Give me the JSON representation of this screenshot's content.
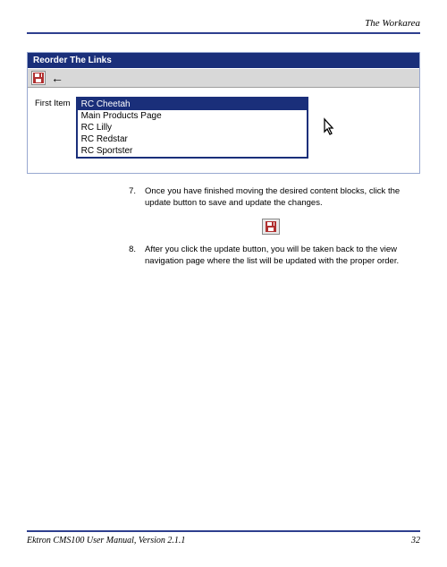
{
  "header": {
    "section_title": "The Workarea"
  },
  "figure": {
    "titlebar": "Reorder The Links",
    "first_item_label": "First Item",
    "options": [
      "RC Cheetah",
      "Main Products Page",
      "RC Lilly",
      "RC Redstar",
      "RC Sportster"
    ],
    "selected_index": 0,
    "back_arrow": "←"
  },
  "steps": [
    {
      "num": "7.",
      "text": "Once you have finished moving the desired content blocks, click the update button to save and update the changes."
    },
    {
      "num": "8.",
      "text": "After you click the update button, you will be taken back to the view navigation page where the list will be updated with the proper order."
    }
  ],
  "footer": {
    "left": "Ektron CMS100 User Manual, Version 2.1.1",
    "right": "32"
  }
}
